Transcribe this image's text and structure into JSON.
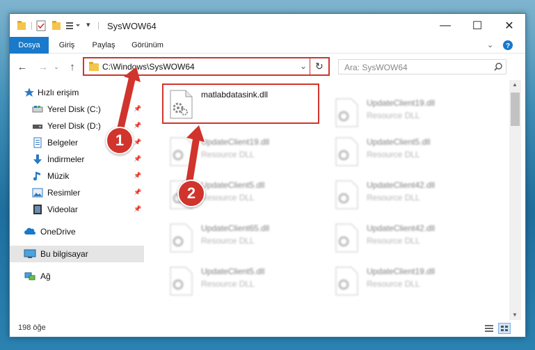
{
  "window": {
    "title": "SysWOW64",
    "minimize_glyph": "—",
    "maximize_glyph": "☐",
    "close_glyph": "✕"
  },
  "ribbon": {
    "tabs": [
      {
        "label": "Dosya",
        "active": true
      },
      {
        "label": "Giriş",
        "active": false
      },
      {
        "label": "Paylaş",
        "active": false
      },
      {
        "label": "Görünüm",
        "active": false
      }
    ]
  },
  "address": {
    "path": "C:\\Windows\\SysWOW64",
    "search_placeholder": "Ara: SysWOW64"
  },
  "sidebar": {
    "items": [
      {
        "label": "Hızlı erişim",
        "icon": "star-icon",
        "pinned": false
      },
      {
        "label": "Yerel Disk (C:)",
        "icon": "drive-icon",
        "pinned": true
      },
      {
        "label": "Yerel Disk (D:)",
        "icon": "drive-icon",
        "pinned": true
      },
      {
        "label": "Belgeler",
        "icon": "documents-icon",
        "pinned": true
      },
      {
        "label": "İndirmeler",
        "icon": "download-icon",
        "pinned": true
      },
      {
        "label": "Müzik",
        "icon": "music-icon",
        "pinned": true
      },
      {
        "label": "Resimler",
        "icon": "pictures-icon",
        "pinned": true
      },
      {
        "label": "Videolar",
        "icon": "videos-icon",
        "pinned": true
      },
      {
        "label": "OneDrive",
        "icon": "cloud-icon",
        "pinned": false
      },
      {
        "label": "Bu bilgisayar",
        "icon": "computer-icon",
        "pinned": false
      },
      {
        "label": "Ağ",
        "icon": "network-icon",
        "pinned": false
      }
    ]
  },
  "files": [
    {
      "name": "matlabdatasink.dll",
      "desc": "",
      "blurred": false
    },
    {
      "name": "UpdateClient19.dll",
      "desc": "Resource DLL",
      "blurred": true
    },
    {
      "name": "UpdateClient19.dll",
      "desc": "Resource DLL",
      "blurred": true
    },
    {
      "name": "UpdateClient5.dll",
      "desc": "Resource DLL",
      "blurred": true
    },
    {
      "name": "UpdateClient5.dll",
      "desc": "Resource DLL",
      "blurred": true
    },
    {
      "name": "UpdateClient42.dll",
      "desc": "Resource DLL",
      "blurred": true
    },
    {
      "name": "UpdateClient65.dll",
      "desc": "Resource DLL",
      "blurred": true
    },
    {
      "name": "UpdateClient42.dll",
      "desc": "Resource DLL",
      "blurred": true
    },
    {
      "name": "UpdateClient5.dll",
      "desc": "Resource DLL",
      "blurred": true
    },
    {
      "name": "UpdateClient19.dll",
      "desc": "Resource DLL",
      "blurred": true
    }
  ],
  "status": {
    "count": "198 öğe"
  },
  "callouts": [
    "1",
    "2"
  ],
  "colors": {
    "accent": "#1979ca",
    "highlight": "#d0342c"
  }
}
